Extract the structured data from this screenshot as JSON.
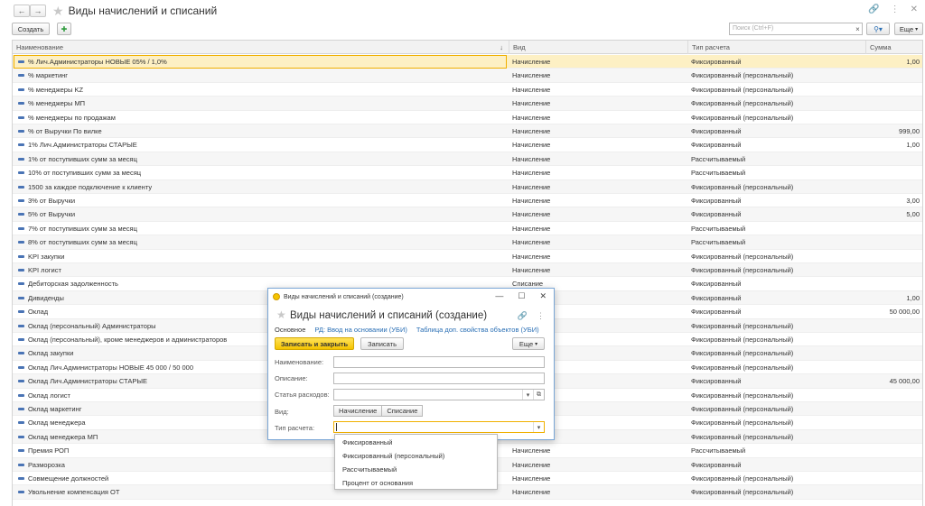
{
  "window": {
    "title": "Виды начислений и списаний"
  },
  "toolbar": {
    "create_label": "Создать",
    "search_placeholder": "Поиск (Ctrl+F)",
    "more_label": "Еще"
  },
  "columns": [
    "Наименование",
    "Вид",
    "Тип расчета",
    "Сумма"
  ],
  "rows": [
    {
      "name": "% Лич.Администраторы НОВЫЕ 05% / 1,0%",
      "kind": "Начисление",
      "type": "Фиксированный",
      "sum": "1,00"
    },
    {
      "name": "% маркетинг",
      "kind": "Начисление",
      "type": "Фиксированный (персональный)",
      "sum": ""
    },
    {
      "name": "% менеджеры KZ",
      "kind": "Начисление",
      "type": "Фиксированный (персональный)",
      "sum": ""
    },
    {
      "name": "% менеджеры МП",
      "kind": "Начисление",
      "type": "Фиксированный (персональный)",
      "sum": ""
    },
    {
      "name": "% менеджеры по продажам",
      "kind": "Начисление",
      "type": "Фиксированный (персональный)",
      "sum": ""
    },
    {
      "name": "% от Выручки По вилке",
      "kind": "Начисление",
      "type": "Фиксированный",
      "sum": "999,00"
    },
    {
      "name": "1% Лич.Администраторы СТАРЫЕ",
      "kind": "Начисление",
      "type": "Фиксированный",
      "sum": "1,00"
    },
    {
      "name": "1% от поступивших сумм за месяц",
      "kind": "Начисление",
      "type": "Рассчитываемый",
      "sum": ""
    },
    {
      "name": "10% от поступивших сумм за месяц",
      "kind": "Начисление",
      "type": "Рассчитываемый",
      "sum": ""
    },
    {
      "name": "1500 за каждое подключение к клиенту",
      "kind": "Начисление",
      "type": "Фиксированный (персональный)",
      "sum": ""
    },
    {
      "name": "3% от Выручки",
      "kind": "Начисление",
      "type": "Фиксированный",
      "sum": "3,00"
    },
    {
      "name": "5% от Выручки",
      "kind": "Начисление",
      "type": "Фиксированный",
      "sum": "5,00"
    },
    {
      "name": "7% от поступивших сумм за месяц",
      "kind": "Начисление",
      "type": "Рассчитываемый",
      "sum": ""
    },
    {
      "name": "8% от поступивших сумм за месяц",
      "kind": "Начисление",
      "type": "Рассчитываемый",
      "sum": ""
    },
    {
      "name": "KPI закупки",
      "kind": "Начисление",
      "type": "Фиксированный (персональный)",
      "sum": ""
    },
    {
      "name": "KPI логист",
      "kind": "Начисление",
      "type": "Фиксированный (персональный)",
      "sum": ""
    },
    {
      "name": "Дебиторская задолженность",
      "kind": "Списание",
      "type": "Фиксированный",
      "sum": ""
    },
    {
      "name": "Дивиденды",
      "kind": "",
      "type": "Фиксированный",
      "sum": "1,00"
    },
    {
      "name": "Оклад",
      "kind": "",
      "type": "Фиксированный",
      "sum": "50 000,00"
    },
    {
      "name": "Оклад (персональный) Администраторы",
      "kind": "",
      "type": "Фиксированный (персональный)",
      "sum": ""
    },
    {
      "name": "Оклад (персональный), кроме менеджеров и администраторов",
      "kind": "",
      "type": "Фиксированный (персональный)",
      "sum": ""
    },
    {
      "name": "Оклад закупки",
      "kind": "",
      "type": "Фиксированный (персональный)",
      "sum": ""
    },
    {
      "name": "Оклад Лич.Администраторы НОВЫЕ 45 000 / 50 000",
      "kind": "",
      "type": "Фиксированный (персональный)",
      "sum": ""
    },
    {
      "name": "Оклад Лич.Администраторы СТАРЫЕ",
      "kind": "",
      "type": "Фиксированный",
      "sum": "45 000,00"
    },
    {
      "name": "Оклад логист",
      "kind": "",
      "type": "Фиксированный (персональный)",
      "sum": ""
    },
    {
      "name": "Оклад маркетинг",
      "kind": "",
      "type": "Фиксированный (персональный)",
      "sum": ""
    },
    {
      "name": "Оклад менеджера",
      "kind": "",
      "type": "Фиксированный (персональный)",
      "sum": ""
    },
    {
      "name": "Оклад менеджера МП",
      "kind": "",
      "type": "Фиксированный (персональный)",
      "sum": ""
    },
    {
      "name": "Премия РОП",
      "kind": "Начисление",
      "type": "Рассчитываемый",
      "sum": ""
    },
    {
      "name": "Разморозка",
      "kind": "Начисление",
      "type": "Фиксированный",
      "sum": ""
    },
    {
      "name": "Совмещение должностей",
      "kind": "Начисление",
      "type": "Фиксированный (персональный)",
      "sum": ""
    },
    {
      "name": "Увольнение компенсация ОТ",
      "kind": "Начисление",
      "type": "Фиксированный (персональный)",
      "sum": ""
    }
  ],
  "dialog": {
    "window_title": "Виды начислений и списаний (создание)",
    "title": "Виды начислений и списаний (создание)",
    "tabs": [
      "Основное",
      "РД: Ввод на основании (УБИ)",
      "Таблица доп. свойства объектов (УБИ)"
    ],
    "save_close_label": "Записать и закрыть",
    "save_label": "Записать",
    "more_label": "Еще",
    "labels": {
      "name": "Наименование:",
      "description": "Описание:",
      "expense": "Статья расходов:",
      "kind": "Вид:",
      "calc_type": "Тип расчета:"
    },
    "values": {
      "name": "",
      "description": "",
      "expense": "",
      "calc_type": ""
    },
    "kind_options": [
      "Начисление",
      "Списание"
    ],
    "calc_type_options": [
      "Фиксированный",
      "Фиксированный (персональный)",
      "Рассчитываемый",
      "Процент от основания"
    ]
  },
  "colors": {
    "selected_row": "#fdf0c4",
    "primary_button": "#f5c400",
    "link": "#2a6fb5"
  }
}
